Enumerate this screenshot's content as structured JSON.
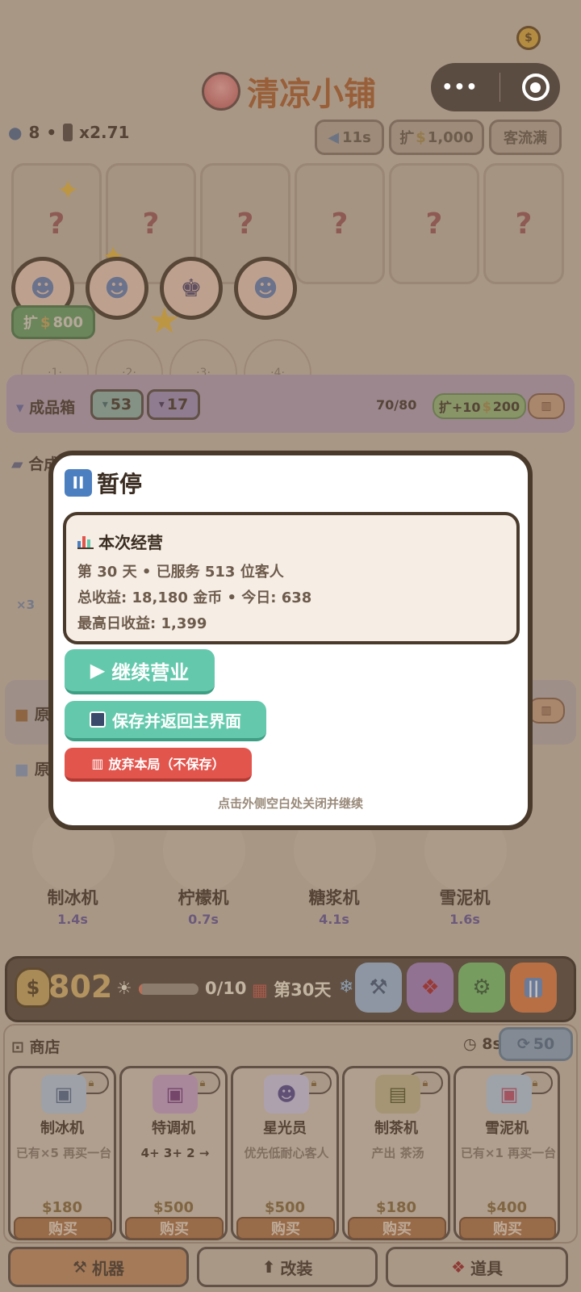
{
  "header": {
    "title": "清凉小铺",
    "coin_icon": "money-bag-icon"
  },
  "stats": {
    "customers": "8",
    "separator": "•",
    "multiplier": "x2.71",
    "ad_timer": "11s",
    "expand_label": "扩",
    "expand_price": "1,000",
    "full_label": "客流满"
  },
  "slots": [
    "?",
    "?",
    "?",
    "?",
    "?",
    "?"
  ],
  "queue": {
    "expand_label": "扩",
    "expand_price": "800",
    "slot_labels": [
      "·1·",
      "·2·",
      "·3·",
      "·4·"
    ]
  },
  "product_box": {
    "title": "成品箱",
    "count_a": "53",
    "count_b": "17",
    "capacity": "70/80",
    "expand_label": "扩+10",
    "expand_price": "200"
  },
  "sections": {
    "merge_prefix": "合成",
    "raw_prefix_1": "原",
    "raw_prefix_2": "原",
    "side_count": "×3"
  },
  "machines": [
    {
      "name": "制冰机",
      "time": "1.4s"
    },
    {
      "name": "柠檬机",
      "time": "0.7s"
    },
    {
      "name": "糖浆机",
      "time": "4.1s"
    },
    {
      "name": "雪泥机",
      "time": "1.6s"
    }
  ],
  "hud": {
    "money": "802",
    "progress_text": "0/10",
    "progress_fraction": 0.05,
    "day": "第30天",
    "colors": {
      "tools": "#9fb6cf",
      "gift": "#a77fb8",
      "settings": "#7cbf6a",
      "pause": "#e07a3e"
    }
  },
  "shop": {
    "title": "商店",
    "timer": "8s",
    "refresh_cost": "50",
    "items": [
      {
        "name": "制冰机",
        "desc": "已有×5 再买一台",
        "price": "180",
        "buy": "购买",
        "icon": "ice-machine-icon"
      },
      {
        "name": "特调机",
        "desc": "4+ 3+ 2 →",
        "price": "500",
        "buy": "购买",
        "icon": "mixer-machine-icon"
      },
      {
        "name": "星光员",
        "desc": "优先低耐心客人",
        "price": "500",
        "buy": "购买",
        "icon": "robot-staff-icon"
      },
      {
        "name": "制茶机",
        "desc": "产出 茶汤",
        "price": "180",
        "buy": "购买",
        "icon": "tea-machine-icon"
      },
      {
        "name": "雪泥机",
        "desc": "已有×1 再买一台",
        "price": "400",
        "buy": "购买",
        "icon": "slush-machine-icon"
      }
    ]
  },
  "tabs": [
    {
      "label": "机器",
      "icon": "wrench-icon"
    },
    {
      "label": "改装",
      "icon": "arrow-up-icon"
    },
    {
      "label": "道具",
      "icon": "gift-icon"
    }
  ],
  "modal": {
    "title": "暂停",
    "summary_title": "本次经营",
    "line1": "第 30 天 • 已服务 513 位客人",
    "line2": "总收益: 18,180 金币 • 今日: 638",
    "line3": "最高日收益: 1,399",
    "continue_label": "继续营业",
    "save_label": "保存并返回主界面",
    "abandon_label": "放弃本局（不保存）",
    "hint": "点击外侧空白处关闭并继续",
    "accent": "#64c9ac",
    "danger": "#e2554d"
  }
}
